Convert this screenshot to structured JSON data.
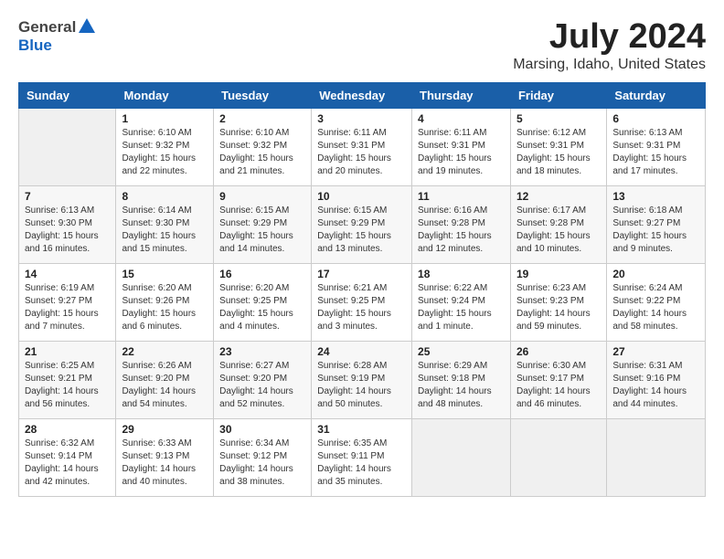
{
  "header": {
    "logo_general": "General",
    "logo_blue": "Blue",
    "month_year": "July 2024",
    "location": "Marsing, Idaho, United States"
  },
  "weekdays": [
    "Sunday",
    "Monday",
    "Tuesday",
    "Wednesday",
    "Thursday",
    "Friday",
    "Saturday"
  ],
  "weeks": [
    [
      {
        "day": "",
        "info": ""
      },
      {
        "day": "1",
        "info": "Sunrise: 6:10 AM\nSunset: 9:32 PM\nDaylight: 15 hours\nand 22 minutes."
      },
      {
        "day": "2",
        "info": "Sunrise: 6:10 AM\nSunset: 9:32 PM\nDaylight: 15 hours\nand 21 minutes."
      },
      {
        "day": "3",
        "info": "Sunrise: 6:11 AM\nSunset: 9:31 PM\nDaylight: 15 hours\nand 20 minutes."
      },
      {
        "day": "4",
        "info": "Sunrise: 6:11 AM\nSunset: 9:31 PM\nDaylight: 15 hours\nand 19 minutes."
      },
      {
        "day": "5",
        "info": "Sunrise: 6:12 AM\nSunset: 9:31 PM\nDaylight: 15 hours\nand 18 minutes."
      },
      {
        "day": "6",
        "info": "Sunrise: 6:13 AM\nSunset: 9:31 PM\nDaylight: 15 hours\nand 17 minutes."
      }
    ],
    [
      {
        "day": "7",
        "info": "Sunrise: 6:13 AM\nSunset: 9:30 PM\nDaylight: 15 hours\nand 16 minutes."
      },
      {
        "day": "8",
        "info": "Sunrise: 6:14 AM\nSunset: 9:30 PM\nDaylight: 15 hours\nand 15 minutes."
      },
      {
        "day": "9",
        "info": "Sunrise: 6:15 AM\nSunset: 9:29 PM\nDaylight: 15 hours\nand 14 minutes."
      },
      {
        "day": "10",
        "info": "Sunrise: 6:15 AM\nSunset: 9:29 PM\nDaylight: 15 hours\nand 13 minutes."
      },
      {
        "day": "11",
        "info": "Sunrise: 6:16 AM\nSunset: 9:28 PM\nDaylight: 15 hours\nand 12 minutes."
      },
      {
        "day": "12",
        "info": "Sunrise: 6:17 AM\nSunset: 9:28 PM\nDaylight: 15 hours\nand 10 minutes."
      },
      {
        "day": "13",
        "info": "Sunrise: 6:18 AM\nSunset: 9:27 PM\nDaylight: 15 hours\nand 9 minutes."
      }
    ],
    [
      {
        "day": "14",
        "info": "Sunrise: 6:19 AM\nSunset: 9:27 PM\nDaylight: 15 hours\nand 7 minutes."
      },
      {
        "day": "15",
        "info": "Sunrise: 6:20 AM\nSunset: 9:26 PM\nDaylight: 15 hours\nand 6 minutes."
      },
      {
        "day": "16",
        "info": "Sunrise: 6:20 AM\nSunset: 9:25 PM\nDaylight: 15 hours\nand 4 minutes."
      },
      {
        "day": "17",
        "info": "Sunrise: 6:21 AM\nSunset: 9:25 PM\nDaylight: 15 hours\nand 3 minutes."
      },
      {
        "day": "18",
        "info": "Sunrise: 6:22 AM\nSunset: 9:24 PM\nDaylight: 15 hours\nand 1 minute."
      },
      {
        "day": "19",
        "info": "Sunrise: 6:23 AM\nSunset: 9:23 PM\nDaylight: 14 hours\nand 59 minutes."
      },
      {
        "day": "20",
        "info": "Sunrise: 6:24 AM\nSunset: 9:22 PM\nDaylight: 14 hours\nand 58 minutes."
      }
    ],
    [
      {
        "day": "21",
        "info": "Sunrise: 6:25 AM\nSunset: 9:21 PM\nDaylight: 14 hours\nand 56 minutes."
      },
      {
        "day": "22",
        "info": "Sunrise: 6:26 AM\nSunset: 9:20 PM\nDaylight: 14 hours\nand 54 minutes."
      },
      {
        "day": "23",
        "info": "Sunrise: 6:27 AM\nSunset: 9:20 PM\nDaylight: 14 hours\nand 52 minutes."
      },
      {
        "day": "24",
        "info": "Sunrise: 6:28 AM\nSunset: 9:19 PM\nDaylight: 14 hours\nand 50 minutes."
      },
      {
        "day": "25",
        "info": "Sunrise: 6:29 AM\nSunset: 9:18 PM\nDaylight: 14 hours\nand 48 minutes."
      },
      {
        "day": "26",
        "info": "Sunrise: 6:30 AM\nSunset: 9:17 PM\nDaylight: 14 hours\nand 46 minutes."
      },
      {
        "day": "27",
        "info": "Sunrise: 6:31 AM\nSunset: 9:16 PM\nDaylight: 14 hours\nand 44 minutes."
      }
    ],
    [
      {
        "day": "28",
        "info": "Sunrise: 6:32 AM\nSunset: 9:14 PM\nDaylight: 14 hours\nand 42 minutes."
      },
      {
        "day": "29",
        "info": "Sunrise: 6:33 AM\nSunset: 9:13 PM\nDaylight: 14 hours\nand 40 minutes."
      },
      {
        "day": "30",
        "info": "Sunrise: 6:34 AM\nSunset: 9:12 PM\nDaylight: 14 hours\nand 38 minutes."
      },
      {
        "day": "31",
        "info": "Sunrise: 6:35 AM\nSunset: 9:11 PM\nDaylight: 14 hours\nand 35 minutes."
      },
      {
        "day": "",
        "info": ""
      },
      {
        "day": "",
        "info": ""
      },
      {
        "day": "",
        "info": ""
      }
    ]
  ]
}
